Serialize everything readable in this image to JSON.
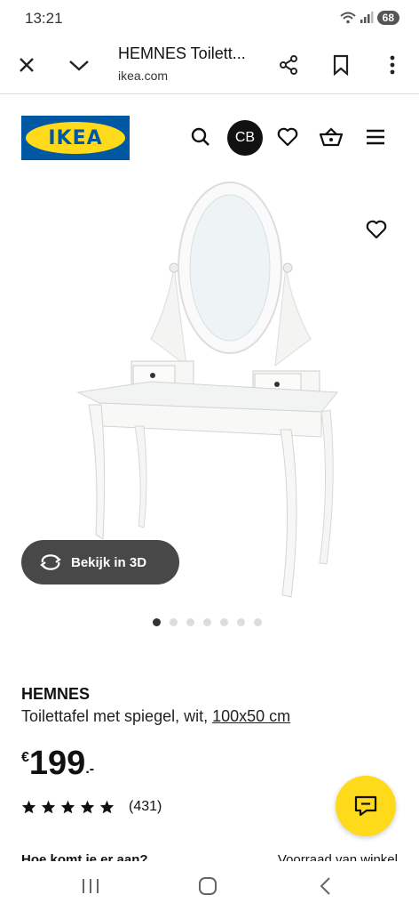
{
  "status": {
    "time": "13:21",
    "battery": "68"
  },
  "browser": {
    "title": "HEMNES Toilett...",
    "url": "ikea.com"
  },
  "header": {
    "logo_text": "IKEA",
    "avatar_initials": "CB"
  },
  "gallery": {
    "view3d_label": "Bekijk in 3D",
    "image_count": 7,
    "active_index": 0
  },
  "product": {
    "name": "HEMNES",
    "description": "Toilettafel met spiegel, wit, ",
    "size": "100x50 cm",
    "currency": "€",
    "price": "199",
    "price_suffix": ".-",
    "rating": 5,
    "review_count": "(431)"
  },
  "cutoff": {
    "left": "Hoe komt je er aan?",
    "right": "Voorraad van winkel"
  },
  "colors": {
    "brand_blue": "#0058a3",
    "brand_yellow": "#ffda1a"
  }
}
